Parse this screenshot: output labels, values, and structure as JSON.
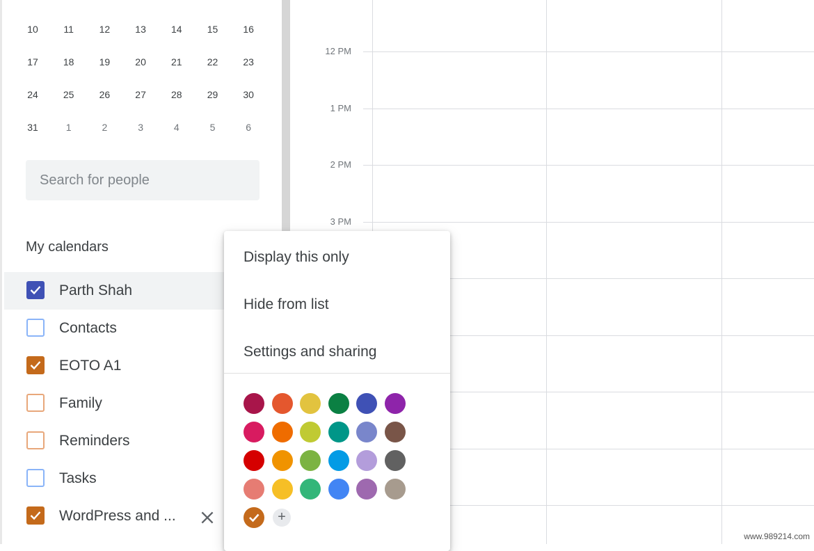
{
  "mini_calendar": {
    "weeks": [
      [
        "10",
        "11",
        "12",
        "13",
        "14",
        "15",
        "16"
      ],
      [
        "17",
        "18",
        "19",
        "20",
        "21",
        "22",
        "23"
      ],
      [
        "24",
        "25",
        "26",
        "27",
        "28",
        "29",
        "30"
      ],
      [
        "31",
        "1",
        "2",
        "3",
        "4",
        "5",
        "6"
      ]
    ]
  },
  "search": {
    "placeholder": "Search for people"
  },
  "my_calendars": {
    "title": "My calendars",
    "items": [
      {
        "label": "Parth Shah",
        "checked": true,
        "color": "#3f51b5"
      },
      {
        "label": "Contacts",
        "checked": false,
        "color": "#8ab4f8"
      },
      {
        "label": "EOTO A1",
        "checked": true,
        "color": "#c46a1b"
      },
      {
        "label": "Family",
        "checked": false,
        "color": "#e8a77a"
      },
      {
        "label": "Reminders",
        "checked": false,
        "color": "#e8a77a"
      },
      {
        "label": "Tasks",
        "checked": false,
        "color": "#8ab4f8"
      },
      {
        "label": "WordPress and ...",
        "checked": true,
        "color": "#c46a1b"
      }
    ],
    "remove_icon": "close-icon"
  },
  "time_grid": {
    "labels": [
      "12 PM",
      "1 PM",
      "2 PM",
      "3 PM"
    ]
  },
  "context_menu": {
    "items": [
      "Display this only",
      "Hide from list",
      "Settings and sharing"
    ],
    "colors": [
      [
        "#a8154a",
        "#e4572e",
        "#e2c33f",
        "#0b8043",
        "#3f51b5",
        "#8e24aa"
      ],
      [
        "#d81b60",
        "#ef6c00",
        "#c0ca33",
        "#009688",
        "#7986cb",
        "#795548"
      ],
      [
        "#d50000",
        "#f09300",
        "#7cb342",
        "#039be5",
        "#b39ddb",
        "#616161"
      ],
      [
        "#e67c73",
        "#f6bf26",
        "#33b679",
        "#4285f4",
        "#9e69af",
        "#a79b8e"
      ]
    ],
    "selected_color": "#c46a1b",
    "add_label": "+"
  },
  "watermark": "www.989214.com"
}
